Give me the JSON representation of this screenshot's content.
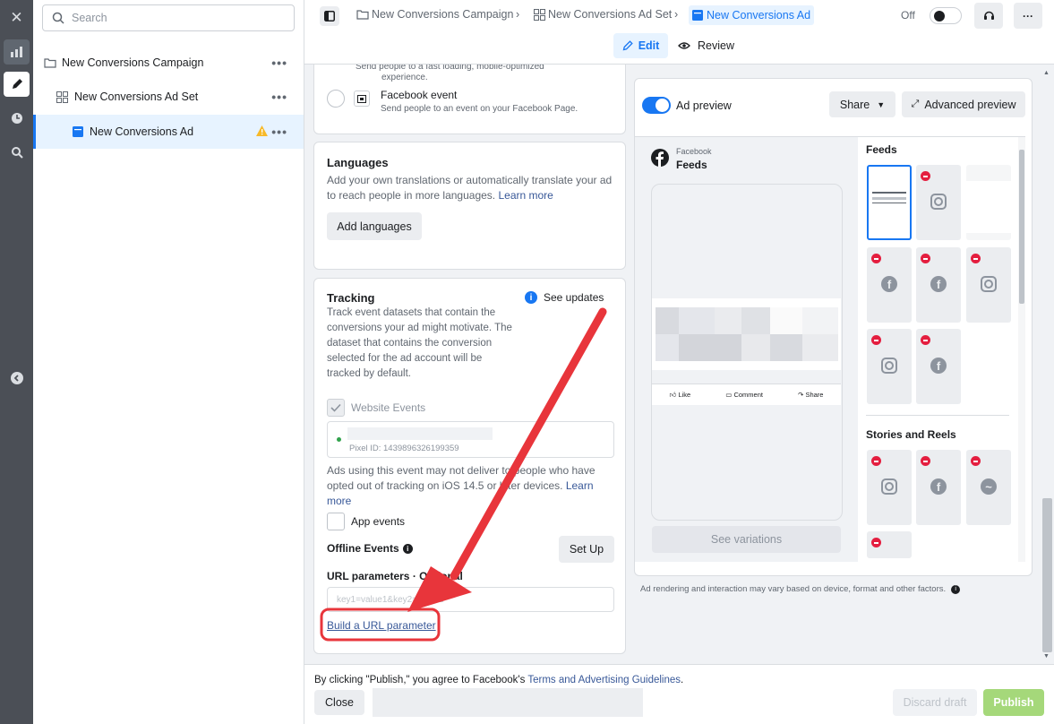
{
  "rail": {
    "icons": [
      "close-icon",
      "chart-icon",
      "pencil-icon",
      "clock-icon",
      "search-icon",
      "collapse-icon"
    ]
  },
  "tree": {
    "search_placeholder": "Search",
    "items": [
      {
        "label": "New Conversions Campaign",
        "icon": "folder-icon"
      },
      {
        "label": "New Conversions Ad Set",
        "icon": "grid-icon"
      },
      {
        "label": "New Conversions Ad",
        "icon": "ad-icon",
        "warning": true
      }
    ],
    "more": "•••"
  },
  "topbar": {
    "breadcrumbs": [
      "New Conversions Campaign",
      "New Conversions Ad Set",
      "New Conversions Ad"
    ],
    "toggle_label": "Off",
    "tabs": {
      "edit": "Edit",
      "review": "Review"
    },
    "more": "···"
  },
  "destination": {
    "cut_text_1": "Send people to a fast loading, mobile-optimized",
    "cut_text_2": "experience.",
    "facebook_event_title": "Facebook event",
    "facebook_event_desc": "Send people to an event on your Facebook Page."
  },
  "languages": {
    "title": "Languages",
    "desc": "Add your own translations or automatically translate your ad to reach people in more languages.",
    "learn_more": "Learn more",
    "button": "Add languages"
  },
  "tracking": {
    "title": "Tracking",
    "see_updates": "See updates",
    "desc": "Track event datasets that contain the conversions your ad might motivate. The dataset that contains the conversion selected for the ad account will be tracked by default.",
    "website_events": "Website Events",
    "pixel_id": "Pixel ID: 1439896326199359",
    "ios_warning_a": "Ads using this event may not deliver to people who have opted out of tracking on iOS 14.5 or later devices.",
    "learn": "Learn",
    "more": "more",
    "app_events": "App events",
    "offline_events": "Offline Events",
    "set_up": "Set Up",
    "url_params_label": "URL parameters · Optional",
    "url_params_placeholder": "key1=value1&key2=value2",
    "build_link": "Build a URL parameter"
  },
  "preview": {
    "ad_preview": "Ad preview",
    "share": "Share",
    "advanced_preview": "Advanced preview",
    "platform": "Facebook",
    "placement": "Feeds",
    "actions": [
      "Like",
      "Comment",
      "Share"
    ],
    "see_variations": "See variations",
    "feeds_heading": "Feeds",
    "stories_heading": "Stories and Reels",
    "note": "Ad rendering and interaction may vary based on device, format and other factors."
  },
  "footer": {
    "terms_prefix": "By clicking \"Publish,\" you agree to Facebook's ",
    "terms_link": "Terms and Advertising Guidelines",
    "terms_suffix": ".",
    "close": "Close",
    "discard": "Discard draft",
    "publish": "Publish"
  },
  "colors": {
    "accent": "#1877f2",
    "annotation_red": "#e8353b",
    "publish_green": "#a5d87a"
  }
}
